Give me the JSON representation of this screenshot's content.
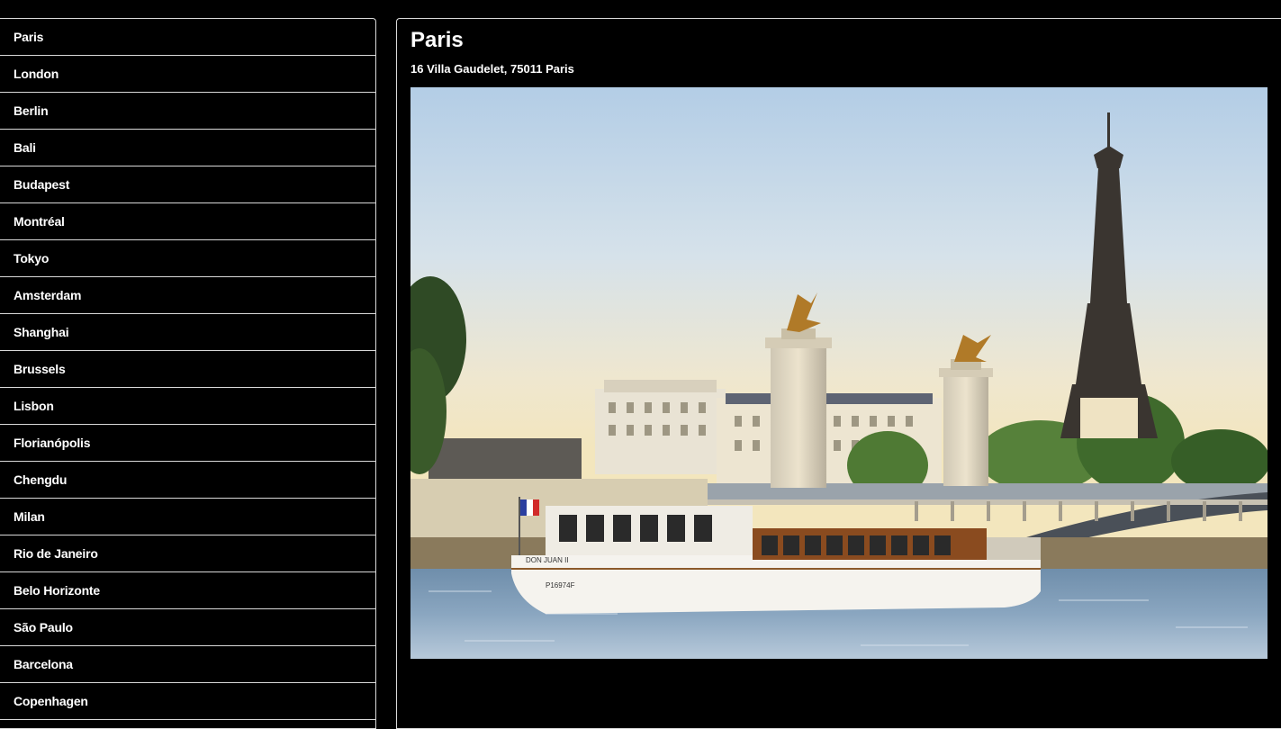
{
  "cities": [
    "Paris",
    "London",
    "Berlin",
    "Bali",
    "Budapest",
    "Montréal",
    "Tokyo",
    "Amsterdam",
    "Shanghai",
    "Brussels",
    "Lisbon",
    "Florianópolis",
    "Chengdu",
    "Milan",
    "Rio de Janeiro",
    "Belo Horizonte",
    "São Paulo",
    "Barcelona",
    "Copenhagen"
  ],
  "detail": {
    "title": "Paris",
    "address": "16 Villa Gaudelet, 75011 Paris",
    "boat_name": "DON JUAN II",
    "boat_registration": "P16974F"
  },
  "colors": {
    "background": "#000000",
    "text": "#ffffff",
    "border": "#d9d9d9"
  }
}
